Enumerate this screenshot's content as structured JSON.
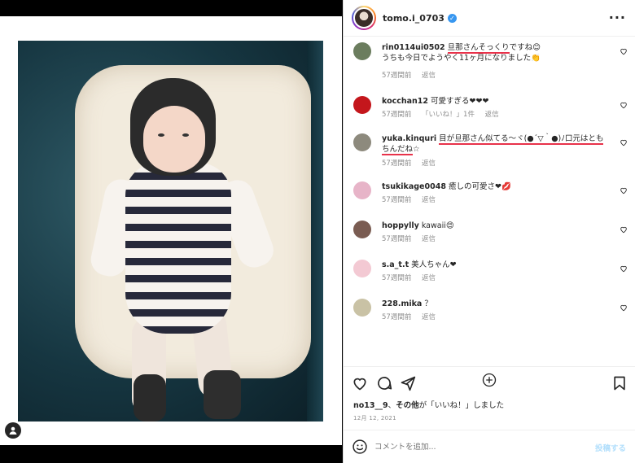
{
  "post": {
    "username": "tomo.i_0703",
    "more_icon": "more-horizontal-icon"
  },
  "comments": [
    {
      "user": "rin0114ui0502",
      "text_hl": "旦那さんそっくり",
      "text_rest": "ですね😊",
      "text_line2": "うちも今日でようやく11ヶ月になりました👏",
      "age": "57週間前",
      "reply": "返信",
      "likes": "",
      "avatar_color": "#6b7d5e"
    },
    {
      "user": "kocchan12",
      "text": "可愛すぎる❤❤❤",
      "age": "57週間前",
      "likes": "「いいね！」1件",
      "reply": "返信",
      "avatar_color": "#c4161c"
    },
    {
      "user": "yuka.kinquri",
      "text_hl": "目が旦那さん似てる〜ヾ(●´▽｀●)ﾉ口元はともちんだね",
      "text_rest": "☆",
      "age": "57週間前",
      "reply": "返信",
      "likes": "",
      "avatar_color": "#8d8a7d"
    },
    {
      "user": "tsukikage0048",
      "text": "癒しの可愛さ❤💋",
      "age": "57週間前",
      "reply": "返信",
      "likes": "",
      "avatar_color": "#e7b4c8"
    },
    {
      "user": "hoppylly",
      "text": "kawaii😍",
      "age": "57週間前",
      "reply": "返信",
      "likes": "",
      "avatar_color": "#7a5c52"
    },
    {
      "user": "s.a_t.t",
      "text": "美人ちゃん❤",
      "age": "57週間前",
      "reply": "返信",
      "likes": "",
      "avatar_color": "#f3c9d3"
    },
    {
      "user": "228.mika",
      "text": "？",
      "age": "57週間前",
      "reply": "返信",
      "likes": "",
      "avatar_color": "#c9c2a5"
    }
  ],
  "liked_by": {
    "user": "no13__9",
    "rest": "、",
    "others": "その他",
    "suffix": "が「いいね！」しました"
  },
  "date": "12月 12, 2021",
  "compose": {
    "placeholder": "コメントを追加...",
    "post_label": "投稿する"
  },
  "colors": {
    "accent": "#3897f0",
    "underline": "#e8324a"
  }
}
